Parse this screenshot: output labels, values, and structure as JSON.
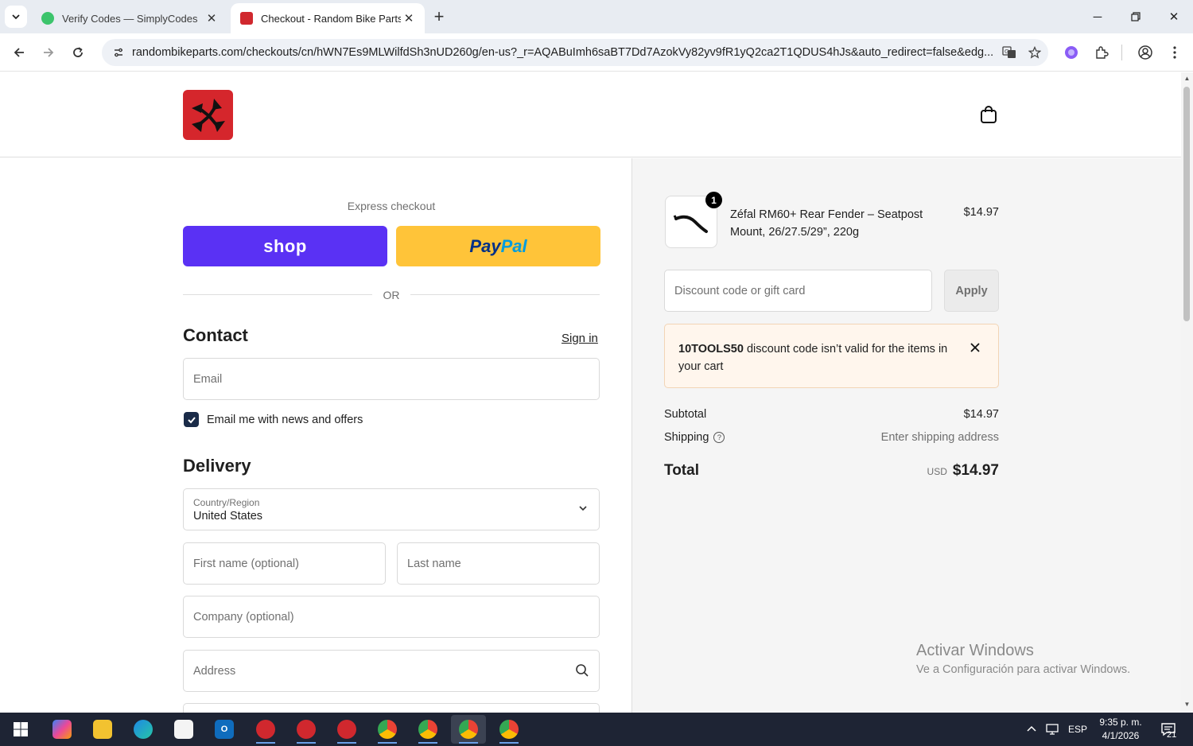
{
  "browser": {
    "tabs": [
      {
        "title": "Verify Codes — SimplyCodes",
        "active": false
      },
      {
        "title": "Checkout - Random Bike Parts",
        "active": true
      }
    ],
    "url": "randombikeparts.com/checkouts/cn/hWN7Es9MLWilfdSh3nUD260g/en-us?_r=AQABuImh6saBT7Dd7AzokVy82yv9fR1yQ2ca2T1QDUS4hJs&auto_redirect=false&edg...",
    "colors": {
      "tabbar": "#e8ecf2",
      "omnibox": "#eef1f6"
    }
  },
  "express": {
    "label": "Express checkout",
    "shop_label": "shop",
    "paypal_part1": "Pay",
    "paypal_part2": "Pal",
    "or_label": "OR",
    "colors": {
      "shop": "#5a31f4",
      "paypal": "#ffc439"
    }
  },
  "contact": {
    "title": "Contact",
    "sign_in": "Sign in",
    "email_placeholder": "Email",
    "newsletter_label": "Email me with news and offers",
    "newsletter_checked": true
  },
  "delivery": {
    "title": "Delivery",
    "country_label": "Country/Region",
    "country_value": "United States",
    "first_name_placeholder": "First name (optional)",
    "last_name_placeholder": "Last name",
    "company_placeholder": "Company (optional)",
    "address_placeholder": "Address"
  },
  "summary": {
    "product": {
      "name": "Zéfal RM60+ Rear Fender – Seatpost Mount, 26/27.5/29”, 220g",
      "price": "$14.97",
      "quantity": "1"
    },
    "discount_placeholder": "Discount code or gift card",
    "apply_label": "Apply",
    "alert_code": "10TOOLS50",
    "alert_text": " discount code isn’t valid for the items in your cart",
    "subtotal_label": "Subtotal",
    "subtotal_value": "$14.97",
    "shipping_label": "Shipping",
    "shipping_help": "?",
    "shipping_value": "Enter shipping address",
    "total_label": "Total",
    "total_currency": "USD",
    "total_value": "$14.97"
  },
  "watermark": {
    "line1": "Activar Windows",
    "line2": "Ve a Configuración para activar Windows."
  },
  "taskbar": {
    "language": "ESP",
    "time": "9:35 p. m.",
    "date": "4/1/2026",
    "notifications": "21"
  }
}
